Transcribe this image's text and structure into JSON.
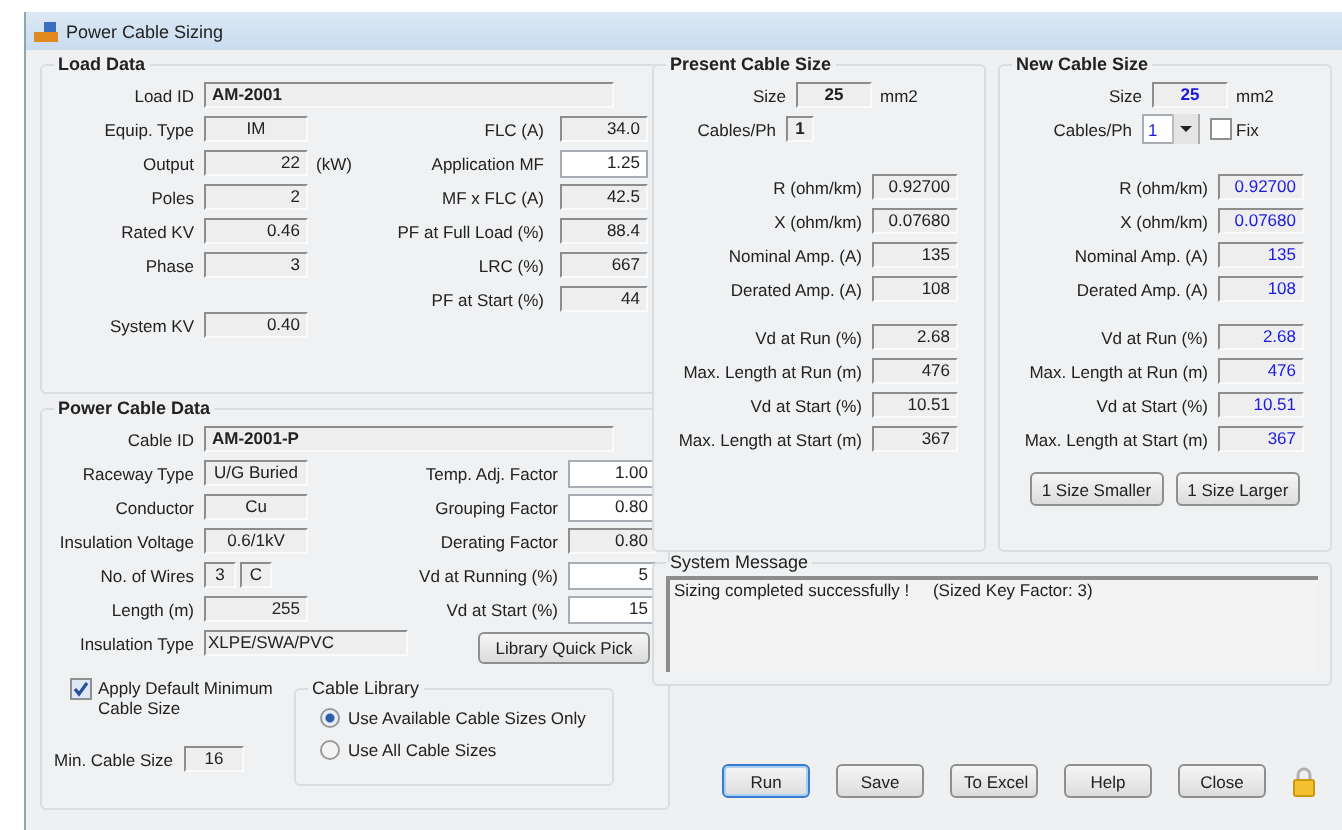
{
  "window": {
    "title": "Power Cable Sizing"
  },
  "load_data": {
    "title": "Load Data",
    "load_id": {
      "label": "Load ID",
      "value": "AM-2001"
    },
    "left": [
      {
        "label": "Equip. Type",
        "value": "IM",
        "kind": "text",
        "editable": false
      },
      {
        "label": "Output",
        "value": "22",
        "kind": "number",
        "editable": false,
        "unit": "(kW)"
      },
      {
        "label": "Poles",
        "value": "2",
        "kind": "number",
        "editable": false
      },
      {
        "label": "Rated KV",
        "value": "0.46",
        "kind": "number",
        "editable": false
      },
      {
        "label": "Phase",
        "value": "3",
        "kind": "number",
        "editable": false
      }
    ],
    "right": [
      {
        "label": "FLC (A)",
        "value": "34.0",
        "kind": "number",
        "editable": false
      },
      {
        "label": "Application MF",
        "value": "1.25",
        "kind": "number",
        "editable": true
      },
      {
        "label": "MF x FLC (A)",
        "value": "42.5",
        "kind": "number",
        "editable": false
      },
      {
        "label": "PF at Full Load (%)",
        "value": "88.4",
        "kind": "number",
        "editable": false
      },
      {
        "label": "LRC (%)",
        "value": "667",
        "kind": "number",
        "editable": false
      },
      {
        "label": "PF at Start (%)",
        "value": "44",
        "kind": "number",
        "editable": false
      }
    ],
    "system_kv": {
      "label": "System KV",
      "value": "0.40",
      "kind": "number",
      "editable": false
    }
  },
  "cable_data": {
    "title": "Power Cable Data",
    "cable_id": {
      "label": "Cable ID",
      "value": "AM-2001-P"
    },
    "left": [
      {
        "label": "Raceway Type",
        "value": "U/G Buried",
        "kind": "text"
      },
      {
        "label": "Conductor",
        "value": "Cu",
        "kind": "text"
      },
      {
        "label": "Insulation Voltage",
        "value": "0.6/1kV",
        "kind": "text"
      },
      {
        "label": "No. of Wires",
        "values": [
          "3",
          "C"
        ],
        "kind": "split"
      },
      {
        "label": "Length (m)",
        "value": "255",
        "kind": "number"
      },
      {
        "label": "Insulation Type",
        "value": "XLPE/SWA/PVC",
        "kind": "wide"
      }
    ],
    "right": [
      {
        "label": "Temp. Adj. Factor",
        "value": "1.00",
        "kind": "number",
        "editable": true
      },
      {
        "label": "Grouping Factor",
        "value": "0.80",
        "kind": "number",
        "editable": true
      },
      {
        "label": "Derating Factor",
        "value": "0.80",
        "kind": "number",
        "editable": false
      },
      {
        "label": "Vd at Running (%)",
        "value": "5",
        "kind": "number",
        "editable": true
      },
      {
        "label": "Vd at Start (%)",
        "value": "15",
        "kind": "number",
        "editable": true
      }
    ],
    "quick_pick_button": "Library Quick Pick",
    "apply_default": {
      "label": "Apply Default Minimum Cable Size",
      "checked": true
    },
    "min_cable_size": {
      "label": "Min. Cable Size",
      "value": "16",
      "kind": "text",
      "editable": false
    },
    "cable_library": {
      "title": "Cable Library",
      "options": [
        {
          "label": "Use Available Cable Sizes Only",
          "selected": true
        },
        {
          "label": "Use All Cable Sizes",
          "selected": false
        }
      ]
    }
  },
  "present_cable": {
    "title": "Present Cable Size",
    "size": {
      "label": "Size",
      "value": "25",
      "unit": "mm2"
    },
    "cables": {
      "label": "Cables/Ph",
      "value": "1"
    },
    "electrical": [
      {
        "label": "R (ohm/km)",
        "value": "0.92700"
      },
      {
        "label": "X (ohm/km)",
        "value": "0.07680"
      },
      {
        "label": "Nominal Amp. (A)",
        "value": "135"
      },
      {
        "label": "Derated Amp. (A)",
        "value": "108"
      }
    ],
    "voltage_drop": [
      {
        "label": "Vd at Run (%)",
        "value": "2.68"
      },
      {
        "label": "Max. Length at Run (m)",
        "value": "476"
      },
      {
        "label": "Vd at Start (%)",
        "value": "10.51"
      },
      {
        "label": "Max. Length at Start (m)",
        "value": "367"
      }
    ]
  },
  "new_cable": {
    "title": "New Cable Size",
    "size": {
      "label": "Size",
      "value": "25",
      "unit": "mm2"
    },
    "cables": {
      "label": "Cables/Ph",
      "value": "1"
    },
    "fix": {
      "label": "Fix",
      "checked": false
    },
    "electrical": [
      {
        "label": "R (ohm/km)",
        "value": "0.92700"
      },
      {
        "label": "X (ohm/km)",
        "value": "0.07680"
      },
      {
        "label": "Nominal Amp. (A)",
        "value": "135"
      },
      {
        "label": "Derated Amp. (A)",
        "value": "108"
      }
    ],
    "voltage_drop": [
      {
        "label": "Vd at Run (%)",
        "value": "2.68"
      },
      {
        "label": "Max. Length at Run (m)",
        "value": "476"
      },
      {
        "label": "Vd at Start (%)",
        "value": "10.51"
      },
      {
        "label": "Max. Length at Start (m)",
        "value": "367"
      }
    ],
    "buttons": [
      "1 Size Smaller",
      "1 Size Larger"
    ]
  },
  "system_message": {
    "title": "System Message",
    "text": "Sizing completed successfully !     (Sized Key Factor: 3)"
  },
  "buttons": [
    {
      "label": "Run",
      "default": true
    },
    {
      "label": "Save",
      "default": false
    },
    {
      "label": "To Excel",
      "default": false
    },
    {
      "label": "Help",
      "default": false
    },
    {
      "label": "Close",
      "default": false
    }
  ]
}
